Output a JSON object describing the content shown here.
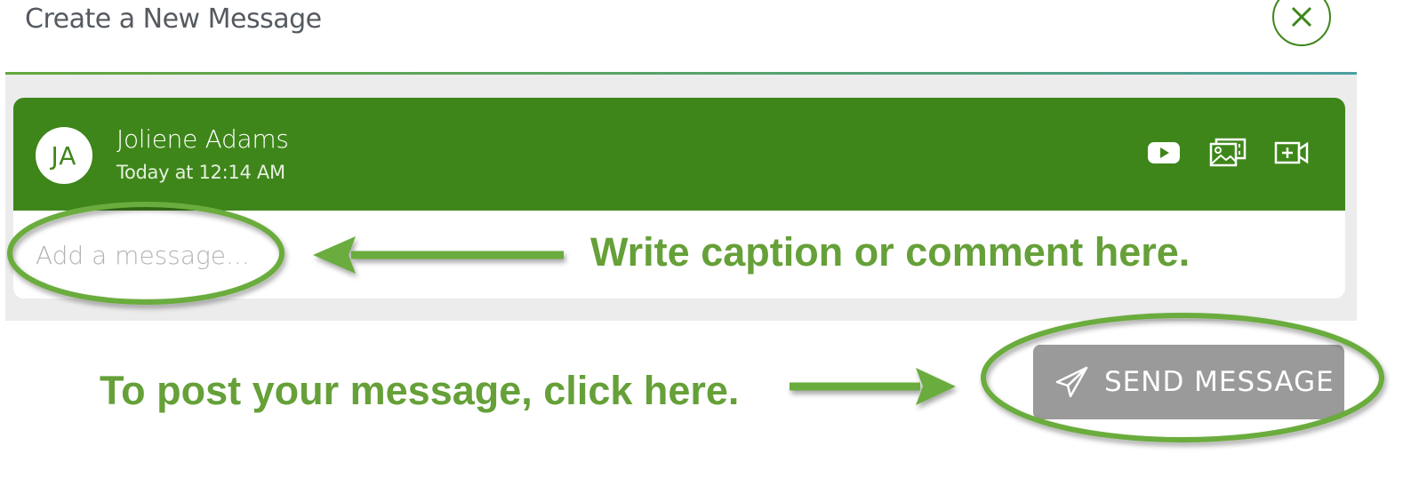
{
  "dialog": {
    "title": "Create a New Message",
    "close_icon": "close-icon"
  },
  "post": {
    "avatar_initials": "JA",
    "author": "Joliene Adams",
    "timestamp": "Today at 12:14 AM",
    "header_icons": [
      "youtube-icon",
      "image-gallery-icon",
      "add-video-icon"
    ]
  },
  "message_input": {
    "placeholder": "Add a message...",
    "value": ""
  },
  "send_button": {
    "label": "SEND MESSAGE",
    "icon": "paper-plane-icon"
  },
  "annotations": {
    "caption_hint": "Write caption or comment here.",
    "send_hint": "To post your message, click here."
  },
  "colors": {
    "brand_green": "#3e861a",
    "annotation_green": "#65a038",
    "button_disabled": "#9a9a9a"
  }
}
